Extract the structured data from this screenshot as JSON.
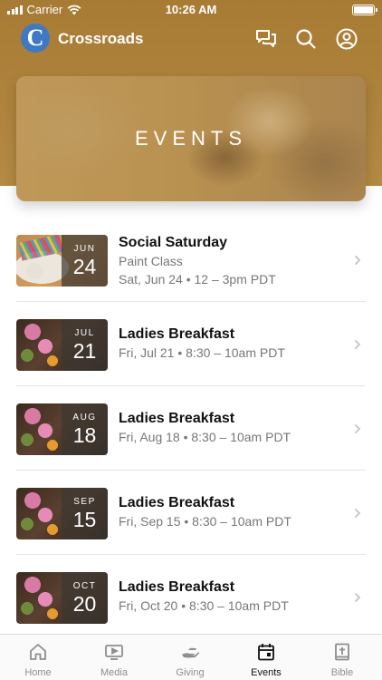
{
  "status_bar": {
    "carrier": "Carrier",
    "time": "10:26 AM"
  },
  "header": {
    "logo_letter": "C",
    "title": "Crossroads"
  },
  "hero": {
    "title": "EVENTS"
  },
  "events": [
    {
      "month": "JUN",
      "day": "24",
      "title": "Social Saturday",
      "subtitle": "Paint Class",
      "when": "Sat, Jun 24 • 12 – 3pm PDT"
    },
    {
      "month": "JUL",
      "day": "21",
      "title": "Ladies Breakfast",
      "when": "Fri, Jul 21 • 8:30 – 10am PDT"
    },
    {
      "month": "AUG",
      "day": "18",
      "title": "Ladies Breakfast",
      "when": "Fri, Aug 18 • 8:30 – 10am PDT"
    },
    {
      "month": "SEP",
      "day": "15",
      "title": "Ladies Breakfast",
      "when": "Fri, Sep 15 • 8:30 – 10am PDT"
    },
    {
      "month": "OCT",
      "day": "20",
      "title": "Ladies Breakfast",
      "when": "Fri, Oct 20 • 8:30 – 10am PDT"
    }
  ],
  "tabs": [
    {
      "label": "Home",
      "icon": "home-icon"
    },
    {
      "label": "Media",
      "icon": "media-icon"
    },
    {
      "label": "Giving",
      "icon": "giving-icon"
    },
    {
      "label": "Events",
      "icon": "events-icon",
      "active": true
    },
    {
      "label": "Bible",
      "icon": "bible-icon"
    }
  ],
  "colors": {
    "header_bg": "#a87b34",
    "logo_bg": "#3f79c3",
    "active_tab": "#111111",
    "inactive_tab": "#8e8e8e"
  }
}
